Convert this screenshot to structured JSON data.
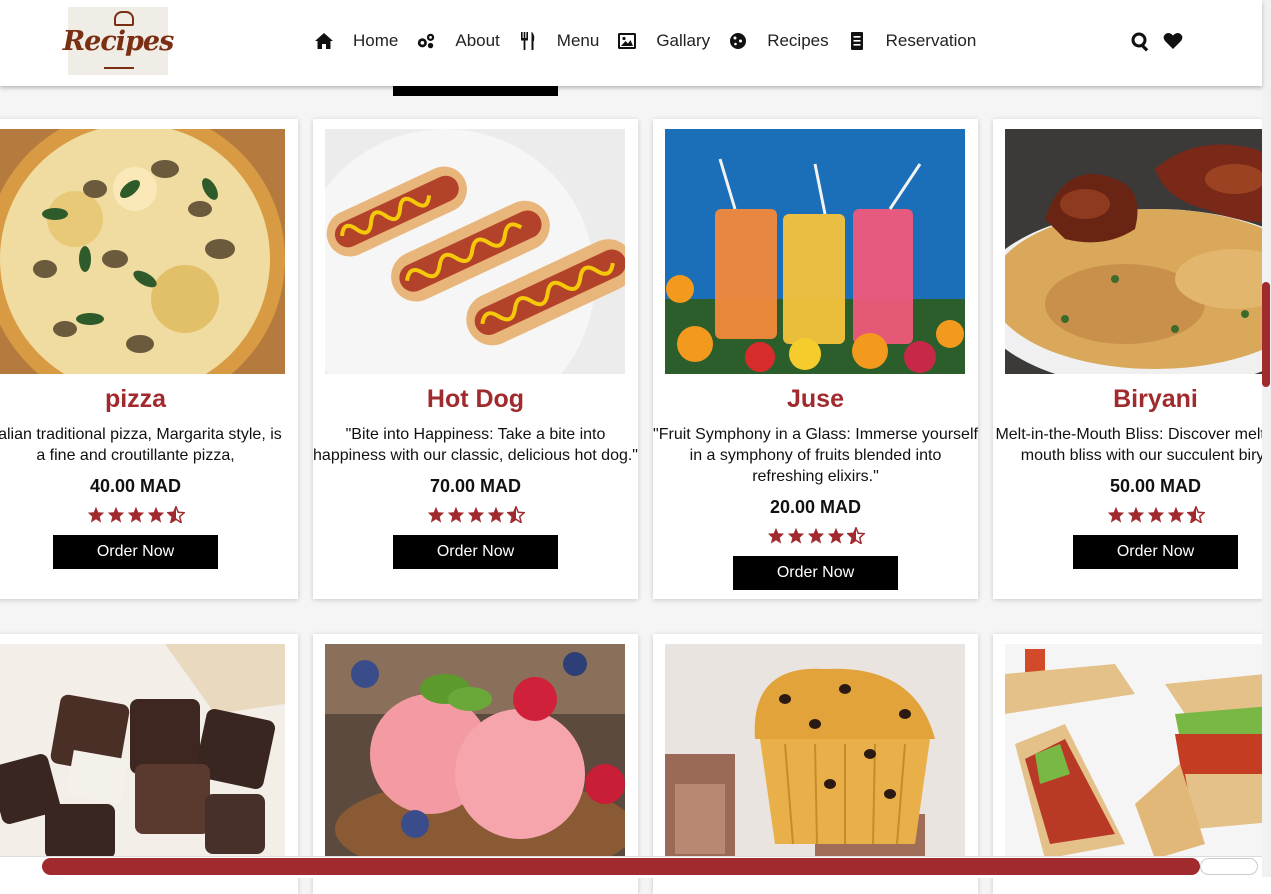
{
  "logo": {
    "text": "Recipes"
  },
  "nav": [
    {
      "label": "Home",
      "icon": "home-icon"
    },
    {
      "label": "About",
      "icon": "gears-icon"
    },
    {
      "label": "Menu",
      "icon": "utensils-icon"
    },
    {
      "label": "Gallary",
      "icon": "image-icon"
    },
    {
      "label": "Recipes",
      "icon": "cookie-icon"
    },
    {
      "label": "Reservation",
      "icon": "receipt-icon"
    }
  ],
  "header_icons": [
    "search-icon",
    "heart-icon"
  ],
  "colors": {
    "accent": "#a02a2d",
    "button": "#000000",
    "header": "#ffffff"
  },
  "cards": [
    {
      "title": "pizza",
      "desc1": "Italian traditional pizza, Margarita style, is",
      "desc2": "a fine and croutillante pizza,",
      "desc3": "",
      "price": "40.00 MAD",
      "rating": 4.5,
      "button": "Order Now"
    },
    {
      "title": "Hot Dog",
      "desc1": "\"Bite into Happiness: Take a bite into",
      "desc2": "happiness with our classic, delicious hot dog.\"",
      "desc3": "",
      "price": "70.00 MAD",
      "rating": 4.5,
      "button": "Order Now"
    },
    {
      "title": "Juse",
      "desc1": "\"Fruit Symphony in a Glass: Immerse yourself",
      "desc2": "in a symphony of fruits blended into",
      "desc3": "refreshing elixirs.\"",
      "price": "20.00 MAD",
      "rating": 4.5,
      "button": "Order Now"
    },
    {
      "title": "Biryani",
      "desc1": "Melt-in-the-Mouth Bliss: Discover melt-in-the-",
      "desc2": "mouth bliss with our succulent biryani.",
      "desc3": "",
      "price": "50.00 MAD",
      "rating": 4.5,
      "button": "Order Now"
    }
  ],
  "bottom_cards": [
    {
      "image": "chocolates-image"
    },
    {
      "image": "ice-cream-image"
    },
    {
      "image": "muffin-image"
    },
    {
      "image": "sandwich-image"
    }
  ]
}
